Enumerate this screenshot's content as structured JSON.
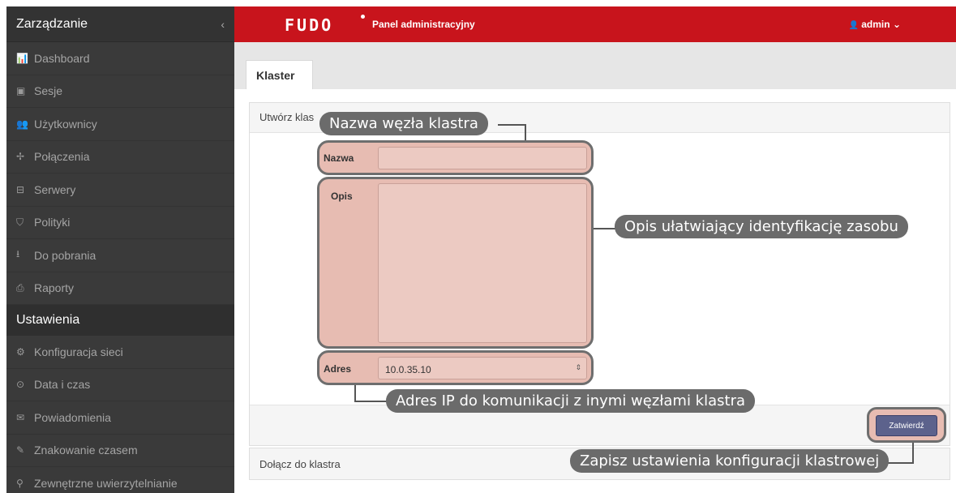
{
  "sidebar": {
    "header": "Zarządzanie",
    "collapse_icon": "‹",
    "items": [
      {
        "label": "Dashboard",
        "icon": "📊"
      },
      {
        "label": "Sesje",
        "icon": "▣"
      },
      {
        "label": "Użytkownicy",
        "icon": "👥"
      },
      {
        "label": "Połączenia",
        "icon": "✢"
      },
      {
        "label": "Serwery",
        "icon": "⊟"
      },
      {
        "label": "Polityki",
        "icon": "⛉"
      },
      {
        "label": "Do pobrania",
        "icon": "⭳"
      },
      {
        "label": "Raporty",
        "icon": "⎙"
      }
    ],
    "section2": "Ustawienia",
    "items2": [
      {
        "label": "Konfiguracja sieci",
        "icon": "⚙"
      },
      {
        "label": "Data i czas",
        "icon": "⊙"
      },
      {
        "label": "Powiadomienia",
        "icon": "✉"
      },
      {
        "label": "Znakowanie czasem",
        "icon": "✎"
      },
      {
        "label": "Zewnętrzne uwierzytelnianie",
        "icon": "⚲"
      }
    ]
  },
  "topbar": {
    "logo": "FUDO",
    "title": "Panel administracyjny",
    "user": "admin",
    "user_icon": "👤",
    "brand_color": "#c8141c"
  },
  "tabs": [
    "Klaster"
  ],
  "panel": {
    "header": "Utwórz klas",
    "footer_panel": "Dołącz do klastra"
  },
  "form": {
    "name_label": "Nazwa",
    "name_value": "",
    "desc_label": "Opis",
    "desc_value": "",
    "addr_label": "Adres",
    "addr_value": "10.0.35.10",
    "submit": "Zatwierdź"
  },
  "callouts": {
    "name": "Nazwa węzła klastra",
    "desc": "Opis ułatwiający identyfikację zasobu",
    "addr": "Adres IP do komunikacji z inymi węzłami klastra",
    "submit": "Zapisz ustawienia konfiguracji klastrowej"
  }
}
